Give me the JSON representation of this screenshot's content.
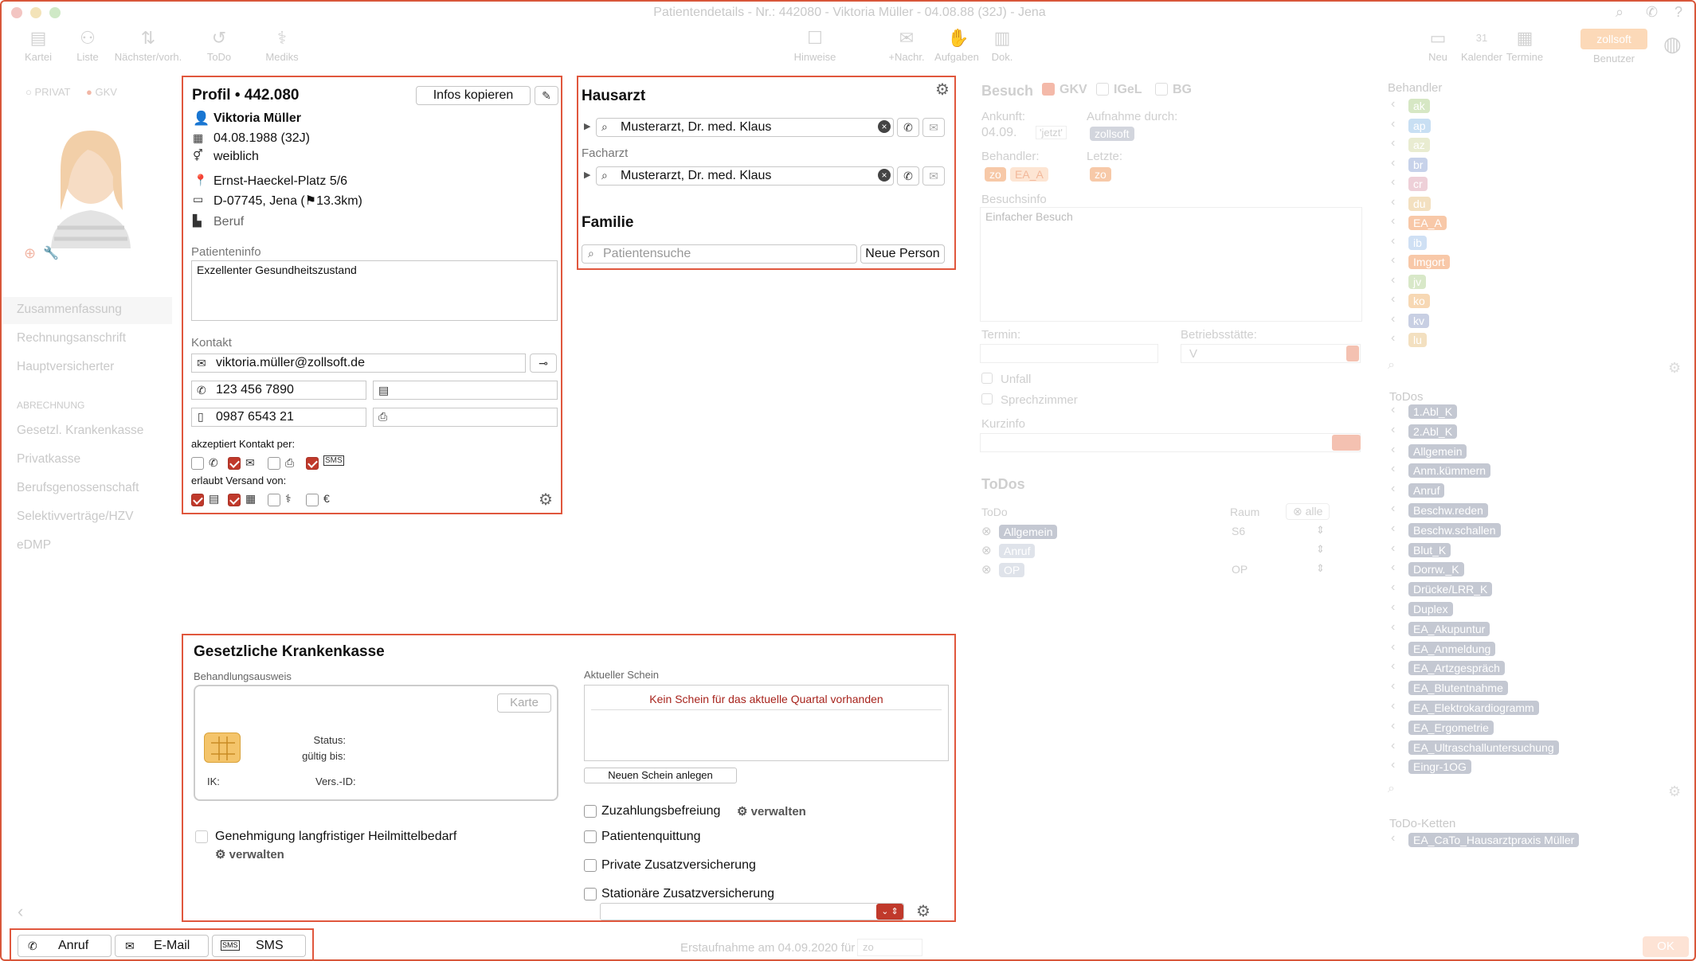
{
  "window": {
    "title": "Patientendetails - Nr.: 442080 - Viktoria Müller - 04.08.88 (32J) - Jena"
  },
  "toolbar": {
    "kartei": "Kartei",
    "liste": "Liste",
    "naechster": "Nächster/vorh.",
    "todo": "ToDo",
    "mediks": "Mediks",
    "hinweise": "Hinweise",
    "nachr": "+Nachr.",
    "aufgaben": "Aufgaben",
    "dok": "Dok.",
    "neu": "Neu",
    "kalender": "Kalender",
    "termine": "Termine",
    "benutzer": "Benutzer",
    "benutzer_badge": "zollsoft",
    "cal_day": "31"
  },
  "sidebar": {
    "privat": "PRIVAT",
    "gkv": "GKV",
    "items": [
      "Zusammenfassung",
      "Rechnungsanschrift",
      "Hauptversicherter"
    ],
    "section": "ABRECHNUNG",
    "abrechnung": [
      "Gesetzl. Krankenkasse",
      "Privatkasse",
      "Berufsgenossenschaft",
      "Selektivverträge/HZV",
      "eDMP"
    ]
  },
  "profil": {
    "title": "Profil • 442.080",
    "copy_button": "Infos kopieren",
    "name": "Viktoria Müller",
    "dob": "04.08.1988 (32J)",
    "gender": "weiblich",
    "street": "Ernst-Haeckel-Platz 5/6",
    "city": "D-07745, Jena (⚑13.3km)",
    "beruf": "Beruf",
    "info_label": "Patienteninfo",
    "info": "Exzellenter Gesundheitszustand",
    "kontakt_label": "Kontakt",
    "email": "viktoria.müller@zollsoft.de",
    "phone": "123 456 7890",
    "mobile": "0987 6543 21",
    "akzeptiert": "akzeptiert Kontakt per:",
    "versand": "erlaubt Versand von:",
    "sms": "SMS"
  },
  "hausarzt": {
    "title": "Hausarzt",
    "arzt": "Musterarzt, Dr. med.  Klaus",
    "facharzt_label": "Facharzt",
    "facharzt": "Musterarzt, Dr. med.  Klaus",
    "familie": "Familie",
    "search_placeholder": "Patientensuche",
    "neue_person": "Neue Person"
  },
  "besuch": {
    "title": "Besuch",
    "gkv": "GKV",
    "igel": "IGeL",
    "bg": "BG",
    "ankunft_label": "Ankunft:",
    "ankunft": "04.09.",
    "jetzt": "'jetzt'",
    "aufnahme_label": "Aufnahme durch:",
    "aufnahme": "zollsoft",
    "behandler_label": "Behandler:",
    "behandler1": "zo",
    "behandler2": "EA_A",
    "letzte_label": "Letzte:",
    "letzte": "zo",
    "info_label": "Besuchsinfo",
    "info": "Einfacher Besuch",
    "termin_label": "Termin:",
    "betrieb_label": "Betriebsstätte:",
    "betrieb": "V",
    "unfall": "Unfall",
    "sprech": "Sprechzimmer",
    "kurzinfo": "Kurzinfo"
  },
  "todos_mid": {
    "title": "ToDos",
    "col_todo": "ToDo",
    "col_raum": "Raum",
    "alle": "alle",
    "rows": [
      {
        "name": "Allgemein",
        "raum": "S6"
      },
      {
        "name": "Anruf",
        "raum": ""
      },
      {
        "name": "OP",
        "raum": "OP"
      }
    ]
  },
  "behandler_list": {
    "title": "Behandler",
    "items": [
      "ak",
      "ap",
      "az",
      "br",
      "cr",
      "du",
      "EA_A",
      "ib",
      "Imgort",
      "jv",
      "ko",
      "kv",
      "lu"
    ]
  },
  "todo_list": {
    "title": "ToDos",
    "items": [
      "1.Abl_K",
      "2.Abl_K",
      "Allgemein",
      "Anm.kümmern",
      "Anruf",
      "Beschw.reden",
      "Beschw.schallen",
      "Blut_K",
      "Dorrw._K",
      "Drücke/LRR_K",
      "Duplex",
      "EA_Akupuntur",
      "EA_Anmeldung",
      "EA_Artzgespräch",
      "EA_Blutentnahme",
      "EA_Elektrokardiogramm",
      "EA_Ergometrie",
      "EA_Ultraschalluntersuchung",
      "Eingr-1OG"
    ]
  },
  "ketten": {
    "title": "ToDo-Ketten",
    "items": [
      "EA_CaTo_Hausarztpraxis Müller"
    ]
  },
  "gkk": {
    "title": "Gesetzliche Krankenkasse",
    "ausweis_label": "Behandlungsausweis",
    "karte": "Karte",
    "status": "Status:",
    "gueltig": "gültig bis:",
    "ik": "IK:",
    "vers": "Vers.-ID:",
    "genehmigung": "Genehmigung langfristiger Heilmittelbedarf",
    "verwalten": "verwalten",
    "schein_label": "Aktueller Schein",
    "kein_schein": "Kein Schein für das aktuelle Quartal vorhanden",
    "neuer_schein": "Neuen Schein anlegen",
    "zuzahlung": "Zuzahlungsbefreiung",
    "verwalten2": "verwalten",
    "quittung": "Patientenquittung",
    "private": "Private Zusatzversicherung",
    "stationaer": "Stationäre Zusatzversicherung"
  },
  "bottom": {
    "anruf": "Anruf",
    "email": "E-Mail",
    "sms": "SMS",
    "erstaufnahme": "Erstaufnahme am 04.09.2020 für",
    "zo": "zo",
    "ok": "OK"
  },
  "colors": {
    "accent": "#e0573d",
    "check": "#c0392b",
    "tag_gray": "#c4c8d2",
    "tag_orange": "#f5c79b"
  }
}
